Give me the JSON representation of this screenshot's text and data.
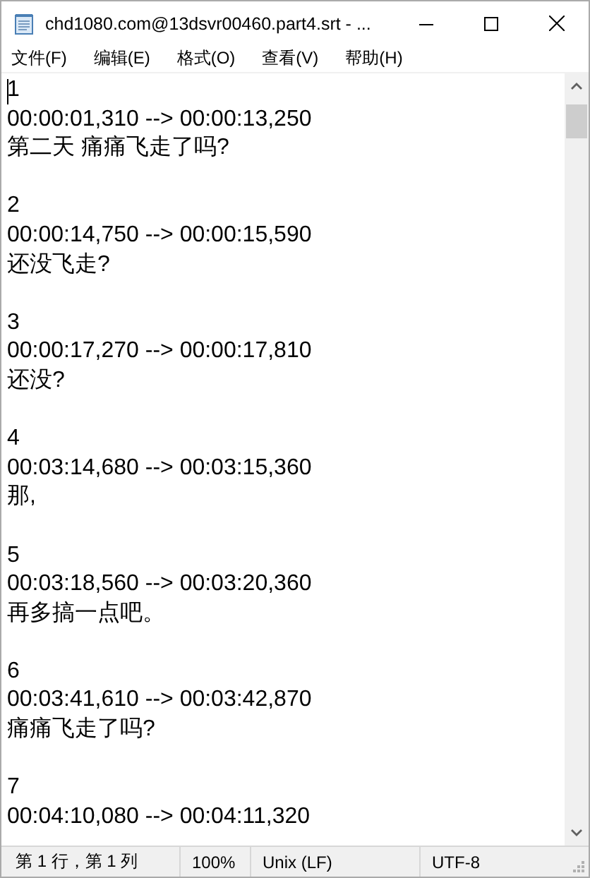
{
  "window": {
    "title": "chd1080.com@13dsvr00460.part4.srt - ..."
  },
  "menu": [
    "文件(F)",
    "编辑(E)",
    "格式(O)",
    "查看(V)",
    "帮助(H)"
  ],
  "entries": [
    {
      "index": "1",
      "time": "00:00:01,310 --> 00:00:13,250",
      "text": "第二天 痛痛飞走了吗?"
    },
    {
      "index": "2",
      "time": "00:00:14,750 --> 00:00:15,590",
      "text": "还没飞走?"
    },
    {
      "index": "3",
      "time": "00:00:17,270 --> 00:00:17,810",
      "text": "还没?"
    },
    {
      "index": "4",
      "time": "00:03:14,680 --> 00:03:15,360",
      "text": "那,"
    },
    {
      "index": "5",
      "time": "00:03:18,560 --> 00:03:20,360",
      "text": "再多搞一点吧。"
    },
    {
      "index": "6",
      "time": "00:03:41,610 --> 00:03:42,870",
      "text": "痛痛飞走了吗?"
    },
    {
      "index": "7",
      "time": "00:04:10,080 --> 00:04:11,320"
    }
  ],
  "status_bar": [
    "第 1 行，第 1 列",
    "100%",
    "Unix (LF)",
    "UTF-8"
  ]
}
